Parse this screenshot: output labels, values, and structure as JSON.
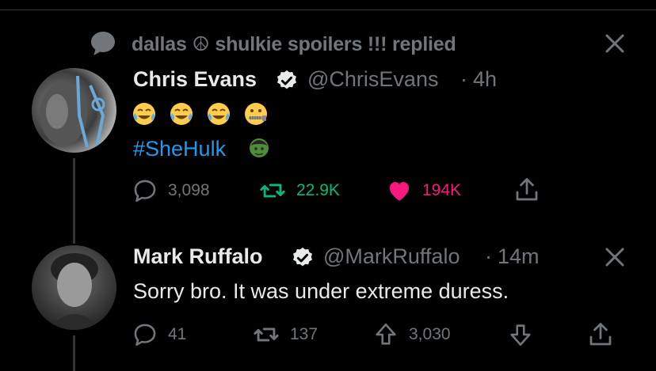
{
  "notice": {
    "text": "dallas ☮ shulkie spoilers !!! replied",
    "icon": "speech-bubble-icon"
  },
  "tweets": [
    {
      "name": "Chris Evans",
      "handle": "@ChrisEvans",
      "separator": "·",
      "time": "4h",
      "emojis": [
        "face-with-tears-of-joy",
        "face-with-tears-of-joy",
        "face-with-tears-of-joy",
        "zipper-mouth-face"
      ],
      "hashtag": "#SheHulk",
      "hashtag_emoji": "hulk-hashflag",
      "actions": {
        "reply_count": "3,098",
        "retweet_count": "22.9K",
        "like_count": "194K"
      },
      "colors": {
        "retweet": "#00ba7c",
        "like": "#f91880"
      }
    },
    {
      "name": "Mark Ruffalo",
      "handle": "@MarkRuffalo",
      "separator": "·",
      "time": "14m",
      "text": "Sorry bro. It was under extreme duress.",
      "actions": {
        "reply_count": "41",
        "retweet_count": "137",
        "upvote_count": "3,030"
      }
    }
  ],
  "colors": {
    "background": "#000000",
    "secondary_text": "#71767b",
    "accent": "#1d9bf0",
    "verified": "#e7e9ea"
  }
}
